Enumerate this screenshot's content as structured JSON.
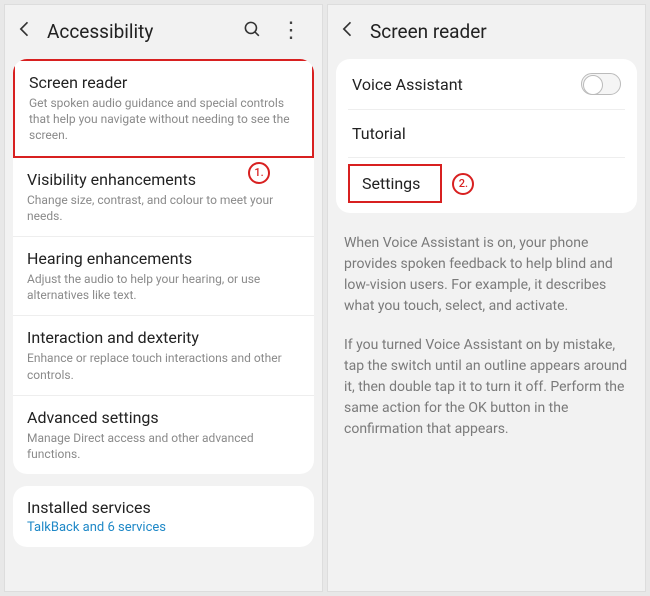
{
  "left": {
    "title": "Accessibility",
    "items": [
      {
        "title": "Screen reader",
        "desc": "Get spoken audio guidance and special controls that help you navigate without needing to see the screen."
      },
      {
        "title": "Visibility enhancements",
        "desc": "Change size, contrast, and colour to meet your needs."
      },
      {
        "title": "Hearing enhancements",
        "desc": "Adjust the audio to help your hearing, or use alternatives like text."
      },
      {
        "title": "Interaction and dexterity",
        "desc": "Enhance or replace touch interactions and other controls."
      },
      {
        "title": "Advanced settings",
        "desc": "Manage Direct access and other advanced functions."
      }
    ],
    "installed": {
      "title": "Installed services",
      "link": "TalkBack and 6 services"
    },
    "callout1": "1."
  },
  "right": {
    "title": "Screen reader",
    "rows": [
      {
        "title": "Voice Assistant"
      },
      {
        "title": "Tutorial"
      },
      {
        "title": "Settings"
      }
    ],
    "callout2": "2.",
    "info1": "When Voice Assistant is on, your phone provides spoken feedback to help blind and low-vision users. For example, it describes what you touch, select, and activate.",
    "info2": "If you turned Voice Assistant on by mistake, tap the switch until an outline appears around it, then double tap it to turn it off. Perform the same action for the OK button in the confirmation that appears."
  }
}
